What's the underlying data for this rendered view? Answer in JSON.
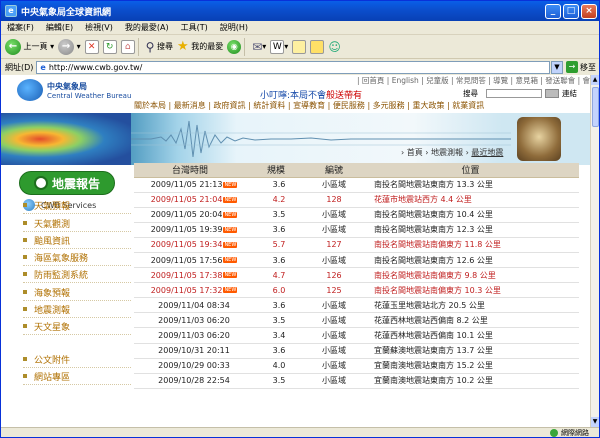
{
  "window": {
    "title": "中央氣象局全球資訊網"
  },
  "menu": [
    "檔案(F)",
    "編輯(E)",
    "檢視(V)",
    "我的最愛(A)",
    "工具(T)",
    "說明(H)"
  ],
  "toolbar": {
    "back": "上一頁",
    "search": "搜尋",
    "favorites": "我的最愛"
  },
  "address": {
    "label": "網址(D)",
    "url": "http://www.cwb.gov.tw/",
    "go": "移至"
  },
  "site": {
    "logo_zh": "中央氣象局",
    "logo_en": "Central Weather Bureau",
    "toplinks": "| 回首頁 | English | 兒童版 | 常見問答 | 導覽 | 意見箱 | 發送聯會 | 會員",
    "search_label": "搜尋",
    "links_label": "連結",
    "slogan_a": "小叮嚀:本局不會",
    "slogan_b": "般送帶有",
    "nav": "關於本局 | 最新消息 | 政府資訊 | 統計資料 | 宣導教育 | 便民服務 | 多元服務 | 重大政策 | 就業資訊",
    "section_button": "地震報告",
    "services_label": "CWB Services",
    "sidebar": [
      "天氣預報",
      "天氣觀測",
      "颱風資訊",
      "海區氣象服務",
      "防雨監測系統",
      "海象預報",
      "地震測報",
      "天文星象",
      "公文附件",
      "網站專區"
    ],
    "breadcrumb": {
      "home": "首頁",
      "eq": "地震測報",
      "latest": "最近地震",
      "sep": "›"
    }
  },
  "table": {
    "headers": [
      "台灣時間",
      "規模",
      "編號",
      "位置"
    ],
    "new_badge": "NEW",
    "rows": [
      {
        "time": "2009/11/05 21:13",
        "mag": "3.6",
        "id": "小區域",
        "loc": "南投名間地震站東南方 13.3 公里",
        "style": "blk",
        "new": true
      },
      {
        "time": "2009/11/05 21:04",
        "mag": "4.2",
        "id": "128",
        "loc": "花蓮市地震站西方 4.4 公里",
        "style": "red",
        "new": true
      },
      {
        "time": "2009/11/05 20:04",
        "mag": "3.5",
        "id": "小區域",
        "loc": "南投名間地震站東南方 10.4 公里",
        "style": "blk",
        "new": true
      },
      {
        "time": "2009/11/05 19:39",
        "mag": "3.6",
        "id": "小區域",
        "loc": "南投名間地震站東南方 12.3 公里",
        "style": "blk",
        "new": true
      },
      {
        "time": "2009/11/05 19:34",
        "mag": "5.7",
        "id": "127",
        "loc": "南投名間地震站南偏東方 11.8 公里",
        "style": "red",
        "new": true
      },
      {
        "time": "2009/11/05 17:56",
        "mag": "3.6",
        "id": "小區域",
        "loc": "南投名間地震站東南方 12.6 公里",
        "style": "blk",
        "new": true
      },
      {
        "time": "2009/11/05 17:38",
        "mag": "4.7",
        "id": "126",
        "loc": "南投名間地震站南偏東方 9.8 公里",
        "style": "red",
        "new": true
      },
      {
        "time": "2009/11/05 17:32",
        "mag": "6.0",
        "id": "125",
        "loc": "南投名間地震站南偏東方 10.3 公里",
        "style": "red",
        "new": true
      },
      {
        "time": "2009/11/04 08:34",
        "mag": "3.6",
        "id": "小區域",
        "loc": "花蓮玉里地震站北方 20.5 公里",
        "style": "blk",
        "new": false
      },
      {
        "time": "2009/11/03 06:20",
        "mag": "3.5",
        "id": "小區域",
        "loc": "花蓮西林地震站西偏南 8.2 公里",
        "style": "blk",
        "new": false
      },
      {
        "time": "2009/11/03 06:20",
        "mag": "3.4",
        "id": "小區域",
        "loc": "花蓮西林地震站西偏南 10.1 公里",
        "style": "blk",
        "new": false
      },
      {
        "time": "2009/10/31 20:11",
        "mag": "3.6",
        "id": "小區域",
        "loc": "宜蘭蘇澳地震站東南方 13.7 公里",
        "style": "blk",
        "new": false
      },
      {
        "time": "2009/10/29 00:33",
        "mag": "4.0",
        "id": "小區域",
        "loc": "宜蘭南澳地震站東南方 15.2 公里",
        "style": "blk",
        "new": false
      },
      {
        "time": "2009/10/28 22:54",
        "mag": "3.5",
        "id": "小區域",
        "loc": "宜蘭南澳地震站東南方 10.2 公里",
        "style": "blk",
        "new": false
      }
    ]
  },
  "status": {
    "zone": "網際網路"
  }
}
